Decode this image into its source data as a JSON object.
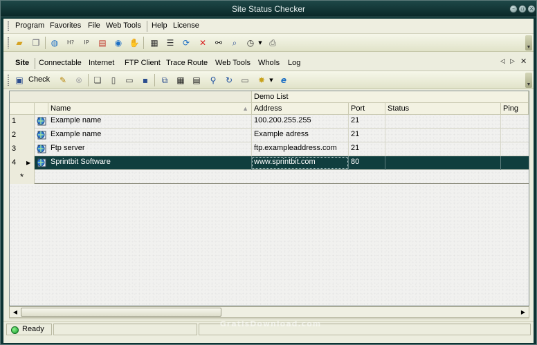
{
  "window": {
    "title": "Site Status Checker"
  },
  "menubar": {
    "items": [
      "Program",
      "Favorites",
      "File",
      "Web Tools",
      "Help",
      "License"
    ]
  },
  "main_toolbar": {
    "icons": [
      "open-folder-icon",
      "save-copy-icon",
      "globe-icon",
      "host-icon",
      "ip-icon",
      "network-icon",
      "tools-globe-icon",
      "hand-icon",
      "properties-icon",
      "list-icon",
      "refresh-icon",
      "delete-icon",
      "binoculars-icon",
      "search-doc-icon",
      "clock-icon",
      "printer-icon"
    ]
  },
  "tabs": {
    "items": [
      "Site",
      "Connectable",
      "Internet",
      "FTP Client",
      "Trace Route",
      "Web Tools",
      "WhoIs",
      "Log"
    ],
    "active": "Site"
  },
  "site_toolbar": {
    "check_label": "Check"
  },
  "grid": {
    "group_header": "Demo List",
    "columns": [
      "Name",
      "Address",
      "Port",
      "Status",
      "Ping"
    ],
    "rows": [
      {
        "num": "1",
        "name": "Example name",
        "address": "100.200.255.255",
        "port": "21",
        "status": ""
      },
      {
        "num": "2",
        "name": "Example name",
        "address": "Example adress",
        "port": "21",
        "status": ""
      },
      {
        "num": "3",
        "name": "Ftp server",
        "address": "ftp.exampleaddress.com",
        "port": "21",
        "status": ""
      },
      {
        "num": "4",
        "name": "Sprintbit Software",
        "address": "www.sprintbit.com",
        "port": "80",
        "status": ""
      }
    ],
    "new_row_marker": "*",
    "selected_row": 4
  },
  "statusbar": {
    "status": "Ready"
  },
  "watermark": "GratisDownload.com",
  "colors": {
    "title_bg": "#0d3434",
    "selection": "#103e3e",
    "status_green": "#119a2a"
  }
}
